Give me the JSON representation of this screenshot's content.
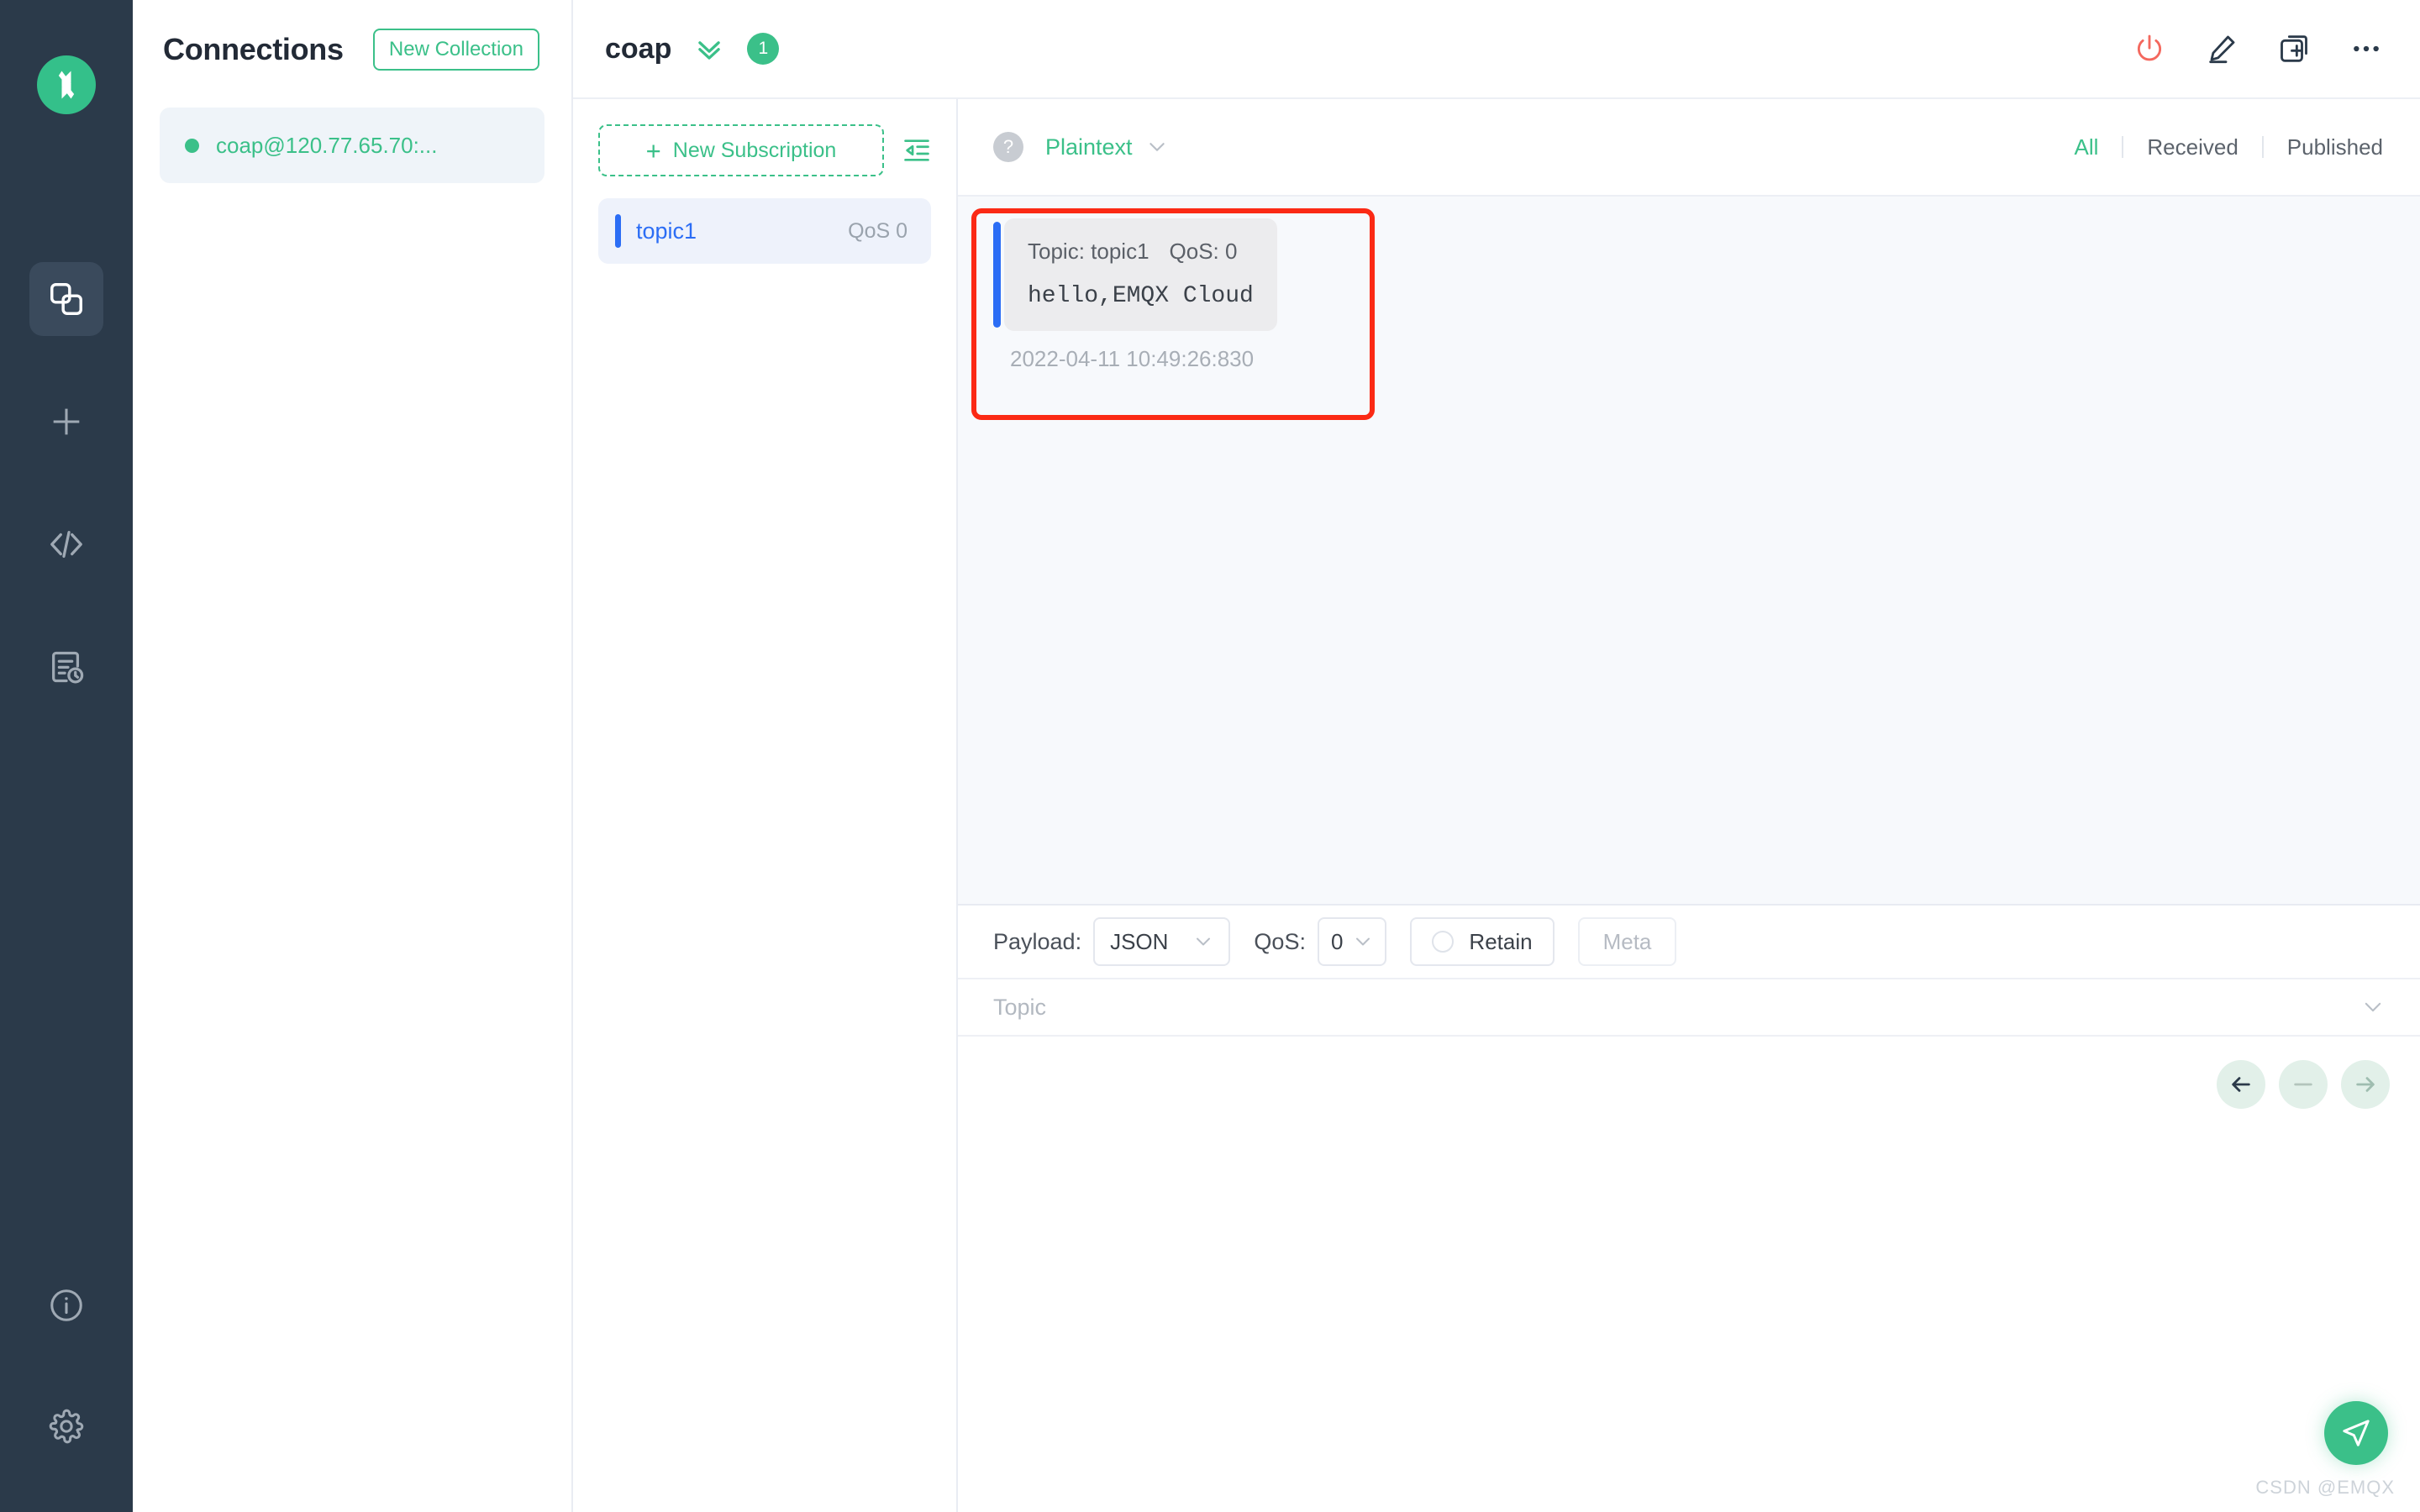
{
  "app": {
    "logo_icon": "emqx-logo-icon",
    "watermark": "CSDN @EMQX"
  },
  "rail": {
    "items": [
      {
        "icon": "connections-icon",
        "name": "connections",
        "active": true
      },
      {
        "icon": "plus-icon",
        "name": "new-connection",
        "active": false
      },
      {
        "icon": "code-icon",
        "name": "script",
        "active": false
      },
      {
        "icon": "log-icon",
        "name": "log",
        "active": false
      }
    ],
    "bottom_items": [
      {
        "icon": "info-icon",
        "name": "about"
      },
      {
        "icon": "gear-icon",
        "name": "settings"
      }
    ]
  },
  "connections": {
    "title": "Connections",
    "new_collection_label": "New Collection",
    "items": [
      {
        "name": "coap@120.77.65.70:...",
        "status": "connected"
      }
    ]
  },
  "header": {
    "title": "coap",
    "chevrons_icon": "double-chevron-down-icon",
    "badge": "1",
    "actions": [
      {
        "icon": "power-icon",
        "name": "disconnect-button",
        "color": "#f4685e"
      },
      {
        "icon": "pencil-icon",
        "name": "edit-connection-button"
      },
      {
        "icon": "duplicate-plus-icon",
        "name": "new-window-button"
      },
      {
        "icon": "more-icon",
        "name": "more-button"
      }
    ]
  },
  "subscriptions": {
    "new_subscription_label": "New Subscription",
    "collapse_icon": "collapse-panel-icon",
    "items": [
      {
        "topic": "topic1",
        "qos": "QoS 0"
      }
    ]
  },
  "messages_toolbar": {
    "help_icon": "question-mark-icon",
    "format": "Plaintext",
    "filters": [
      {
        "label": "All",
        "active": true
      },
      {
        "label": "Received",
        "active": false
      },
      {
        "label": "Published",
        "active": false
      }
    ]
  },
  "messages": [
    {
      "topic_label": "Topic: topic1",
      "qos_label": "QoS: 0",
      "payload": "hello,EMQX Cloud",
      "time": "2022-04-11 10:49:26:830",
      "direction": "received"
    }
  ],
  "publish": {
    "payload_label": "Payload:",
    "payload_value": "JSON",
    "qos_label": "QoS:",
    "qos_value": "0",
    "retain_label": "Retain",
    "retain_checked": false,
    "meta_label": "Meta",
    "topic_placeholder": "Topic",
    "nav": [
      {
        "icon": "arrow-left-icon",
        "name": "prev-payload-button"
      },
      {
        "icon": "minus-icon",
        "name": "clear-payload-button"
      },
      {
        "icon": "arrow-right-icon",
        "name": "next-payload-button"
      }
    ],
    "send_icon": "send-icon"
  },
  "colors": {
    "brand_green": "#3bc089",
    "rail_bg": "#2b3a4a",
    "accent_blue": "#2b6df5",
    "danger_red": "#f4685e",
    "annotation_red": "#fb2a15"
  }
}
